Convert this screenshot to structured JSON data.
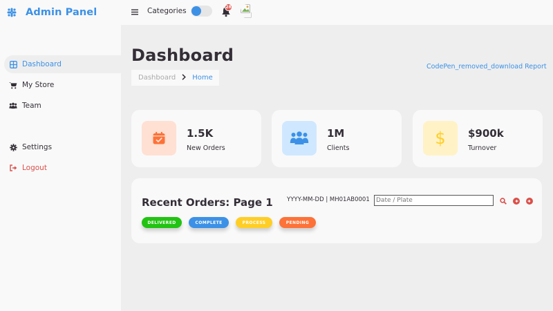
{
  "sidebar": {
    "brand": "Admin Panel",
    "items": [
      {
        "label": "Dashboard",
        "icon": "dashboard-grid-icon",
        "active": true
      },
      {
        "label": "My Store",
        "icon": "cart-icon"
      },
      {
        "label": "Team",
        "icon": "people-group-icon"
      }
    ],
    "bottom": [
      {
        "label": "Settings",
        "icon": "gear-icon"
      },
      {
        "label": "Logout",
        "icon": "logout-icon"
      }
    ]
  },
  "navbar": {
    "menu_icon": "hamburger-icon",
    "categories": "Categories",
    "notification_count": "28"
  },
  "main": {
    "title": "Dashboard",
    "breadcrumb": {
      "previous": "Dashboard",
      "current": "Home"
    },
    "download_label": "CodePen_removed_download Report",
    "stats": [
      {
        "value": "1.5K",
        "caption": "New Orders",
        "icon": "calendar-check-icon"
      },
      {
        "value": "1M",
        "caption": "Clients",
        "icon": "people-group-icon"
      },
      {
        "value": "$900k",
        "caption": "Turnover",
        "icon": "dollar-icon"
      }
    ],
    "orders": {
      "title": "Recent Orders: Page 1",
      "format_hint": "YYYY-MM-DD | MH01AB0001",
      "search_placeholder": "Date / Plate",
      "statuses": [
        "DELIVERED",
        "COMPLETE",
        "PROCESS",
        "PENDING"
      ]
    }
  },
  "colors": {
    "accent": "#3c91e6",
    "delivered": "#22c312",
    "complete": "#3c91e6",
    "process": "#ffce26",
    "pending": "#fd7238",
    "danger": "#db504a"
  }
}
